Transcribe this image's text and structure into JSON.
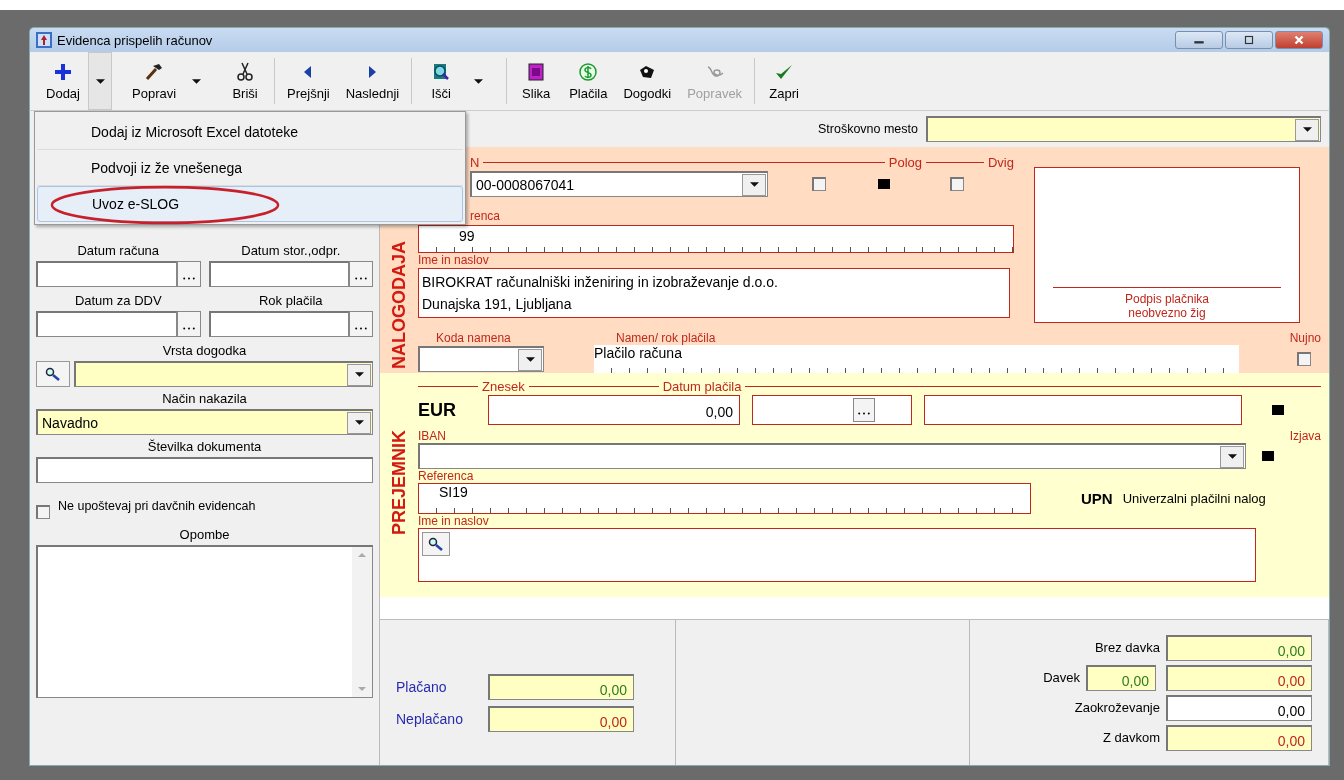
{
  "window": {
    "title": "Evidenca prispelih računov"
  },
  "toolbar": [
    {
      "label": "Dodaj",
      "dropdown": true,
      "disabled": false
    },
    {
      "label": "Popravi",
      "dropdown": true,
      "disabled": false
    },
    {
      "label": "Briši",
      "dropdown": false,
      "disabled": false
    },
    {
      "label": "Prejšnji",
      "dropdown": false,
      "disabled": false
    },
    {
      "label": "Naslednji",
      "dropdown": false,
      "disabled": false
    },
    {
      "label": "Išči",
      "dropdown": true,
      "disabled": false
    },
    {
      "label": "Slika",
      "dropdown": false,
      "disabled": false
    },
    {
      "label": "Plačila",
      "dropdown": false,
      "disabled": false
    },
    {
      "label": "Dogodki",
      "dropdown": false,
      "disabled": false
    },
    {
      "label": "Popravek",
      "dropdown": false,
      "disabled": true
    },
    {
      "label": "Zapri",
      "dropdown": false,
      "disabled": false
    }
  ],
  "menu": [
    {
      "label": "Dodaj iz Microsoft Excel datoteke",
      "selected": false,
      "circled": false
    },
    {
      "label": "Podvoji iz že vnešenega",
      "selected": false,
      "circled": false
    },
    {
      "label": "Uvoz e-SLOG",
      "selected": true,
      "circled": true
    }
  ],
  "cost_center": {
    "label": "Stroškovno mesto"
  },
  "left": {
    "date_invoice": {
      "label": "Datum računa"
    },
    "date_storno": {
      "label": "Datum stor.,odpr."
    },
    "date_vat": {
      "label": "Datum za DDV"
    },
    "due_date": {
      "label": "Rok plačila"
    },
    "event_type": {
      "label": "Vrsta dogodka"
    },
    "transfer": {
      "label": "Način nakazila",
      "value": "Navadno"
    },
    "doc_number": {
      "label": "Številka dokumenta"
    },
    "ignore_tax": {
      "label": "Ne upoštevaj pri davčnih evidencah",
      "checked": false
    },
    "notes": {
      "label": "Opombe"
    }
  },
  "payer": {
    "title": "NALOGODAJA",
    "iban_label": "N",
    "iban": "00-0008067041",
    "deposit": {
      "label": "Polog",
      "checked": false
    },
    "withdraw": {
      "label": "Dvig",
      "checked": false
    },
    "reference_label": "renca",
    "reference": "99",
    "name_label": "Ime in naslov",
    "name_lines": [
      "BIROKRAT računalniški inženiring in izobraževanje d.o.o.",
      "Dunajska 191, Ljubljana"
    ],
    "purpose_code_label": "Koda namena",
    "purpose_label": "Namen/ rok plačila",
    "purpose": "Plačilo računa",
    "urgent": {
      "label": "Nujno",
      "checked": false
    },
    "signature": [
      "Podpis plačnika",
      "neobvezno žig"
    ]
  },
  "payee": {
    "title": "PREJEMNIK",
    "amount_label": "Znesek",
    "date_label": "Datum plačila",
    "currency": "EUR",
    "amount": "0,00",
    "iban_label": "IBAN",
    "statement_label": "Izjava",
    "reference_label": "Referenca",
    "reference": "SI19",
    "upn": "UPN",
    "upn_text": "Univerzalni plačilni nalog",
    "name_label": "Ime in naslov"
  },
  "paid": [
    {
      "label": "Plačano",
      "value": "0,00",
      "color": "#2e7d1a"
    },
    {
      "label": "Neplačano",
      "value": "0,00",
      "color": "#c0281c"
    }
  ],
  "totals": [
    {
      "label": "Brez davka",
      "value": "0,00",
      "color": "#2e7d1a",
      "kind": "computed"
    },
    {
      "label": "Davek",
      "extra": "0,00",
      "value": "0,00",
      "color": "#c0281c",
      "kind": "computed"
    },
    {
      "label": "Zaokroževanje",
      "value": "0,00",
      "color": "#000000",
      "kind": "input"
    },
    {
      "label": "Z davkom",
      "value": "0,00",
      "color": "#c0281c",
      "kind": "computed"
    }
  ]
}
